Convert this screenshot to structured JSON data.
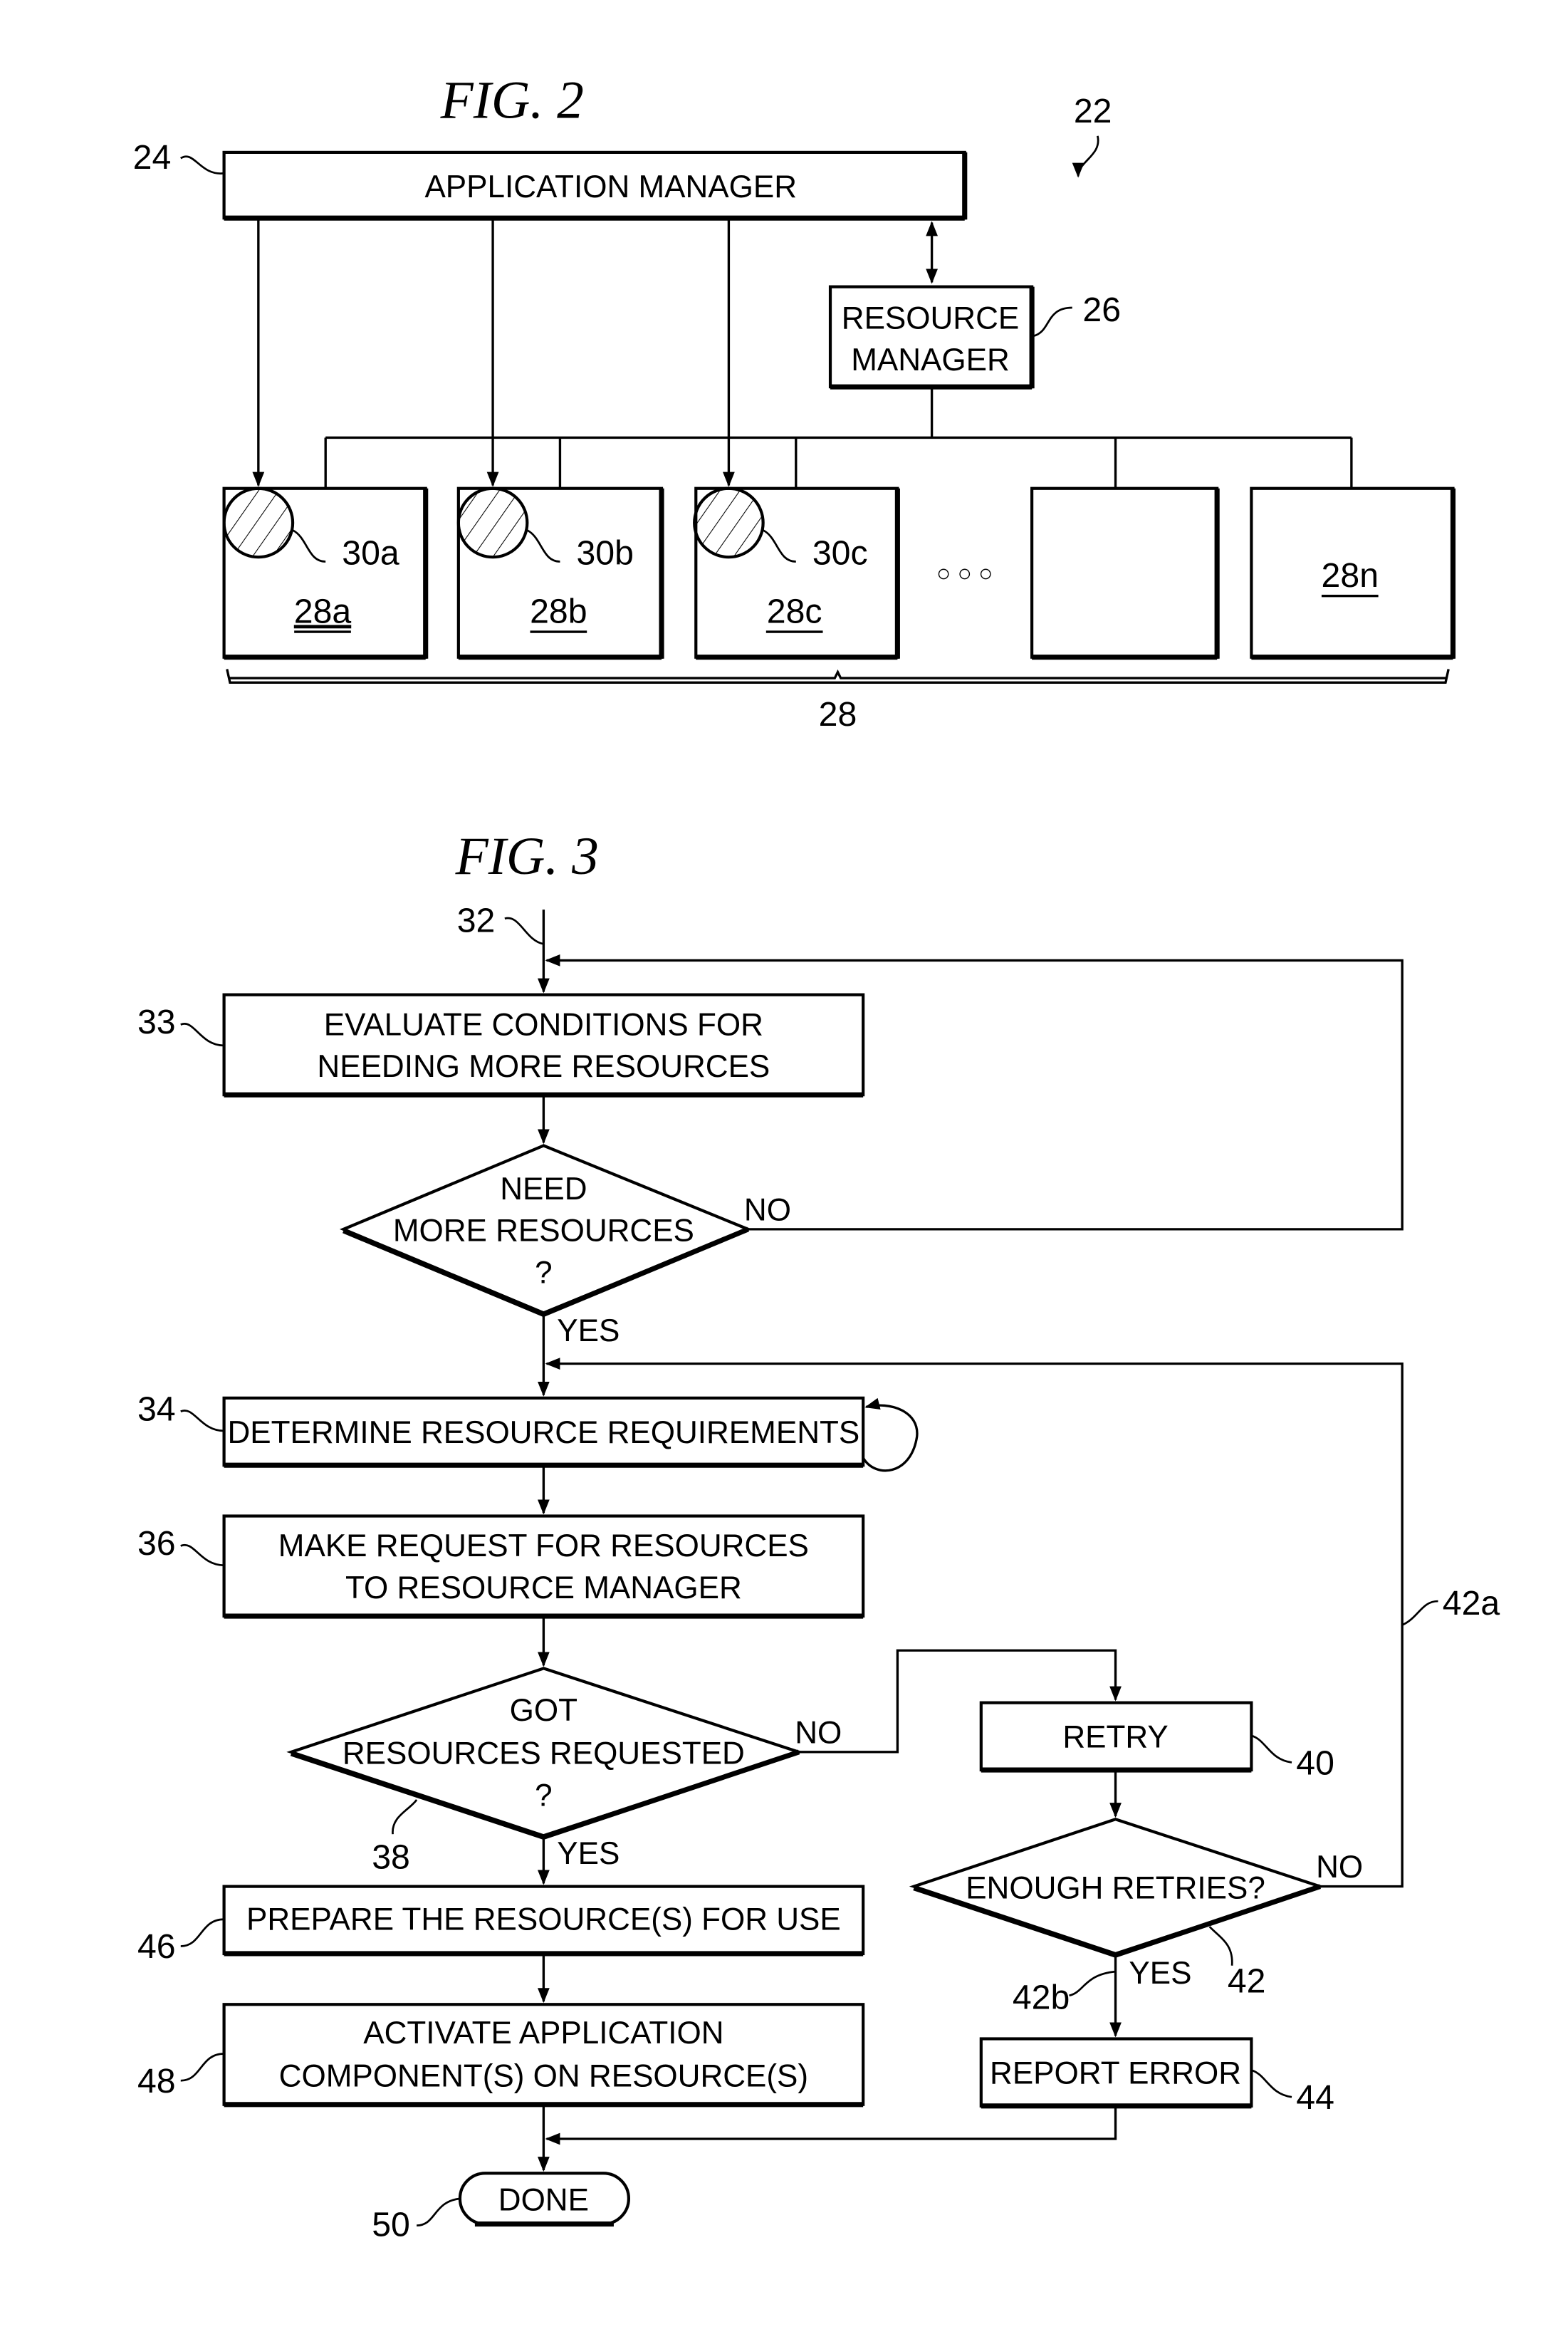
{
  "fig2": {
    "title": "FIG. 2",
    "system_ref": "22",
    "application_manager": {
      "label": "APPLICATION MANAGER",
      "ref": "24"
    },
    "resource_manager": {
      "line1": "RESOURCE",
      "line2": "MANAGER",
      "ref": "26"
    },
    "resources": [
      {
        "label": "28a",
        "component_ref": "30a"
      },
      {
        "label": "28b",
        "component_ref": "30b"
      },
      {
        "label": "28c",
        "component_ref": "30c"
      },
      {
        "label": ""
      },
      {
        "label": "28n"
      }
    ],
    "ellipsis": "○ ○ ○",
    "group_ref": "28"
  },
  "fig3": {
    "title": "FIG. 3",
    "start_ref": "32",
    "steps": {
      "evaluate": {
        "line1": "EVALUATE CONDITIONS FOR",
        "line2": "NEEDING MORE RESOURCES",
        "ref": "33"
      },
      "need_more": {
        "line1": "NEED",
        "line2": "MORE RESOURCES",
        "line3": "?",
        "no": "NO",
        "yes": "YES"
      },
      "determine": {
        "label": "DETERMINE RESOURCE REQUIREMENTS",
        "ref": "34"
      },
      "make_request": {
        "line1": "MAKE REQUEST FOR RESOURCES",
        "line2": "TO RESOURCE MANAGER",
        "ref": "36"
      },
      "got_resources": {
        "line1": "GOT",
        "line2": "RESOURCES REQUESTED",
        "line3": "?",
        "ref": "38",
        "no": "NO",
        "yes": "YES"
      },
      "retry": {
        "label": "RETRY",
        "ref": "40"
      },
      "enough_retries": {
        "label": "ENOUGH RETRIES?",
        "ref": "42",
        "no": "NO",
        "yes": "YES",
        "no_path_ref": "42a",
        "yes_path_ref": "42b"
      },
      "report_error": {
        "label": "REPORT ERROR",
        "ref": "44"
      },
      "prepare": {
        "label": "PREPARE THE RESOURCE(S) FOR USE",
        "ref": "46"
      },
      "activate": {
        "line1": "ACTIVATE APPLICATION",
        "line2": "COMPONENT(S) ON RESOURCE(S)",
        "ref": "48"
      },
      "done": {
        "label": "DONE",
        "ref": "50"
      }
    }
  }
}
